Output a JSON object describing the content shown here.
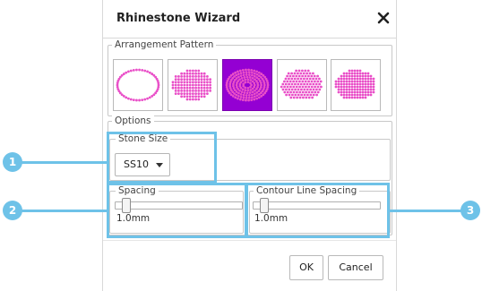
{
  "dialog": {
    "title": "Rhinestone Wizard",
    "close_icon": "close-icon"
  },
  "arrangement": {
    "legend": "Arrangement Pattern",
    "patterns": [
      {
        "name": "outline-ellipse",
        "selected": false
      },
      {
        "name": "horizontal-rows-fill",
        "selected": false
      },
      {
        "name": "concentric-contour-fill",
        "selected": true
      },
      {
        "name": "diagonal-fill",
        "selected": false
      },
      {
        "name": "grid-fill",
        "selected": false
      }
    ],
    "stone_color": "#e94fc8",
    "selected_bg": "#9400d3"
  },
  "options": {
    "legend": "Options",
    "stone_size": {
      "legend": "Stone Size",
      "value": "SS10"
    },
    "spacing": {
      "legend": "Spacing",
      "value_text": "1.0mm",
      "level": 0.05
    },
    "contour_line_spacing": {
      "legend": "Contour Line Spacing",
      "value_text": "1.0mm",
      "level": 0.05
    }
  },
  "buttons": {
    "ok": "OK",
    "cancel": "Cancel"
  },
  "callouts": {
    "color": "#6ec2e8",
    "labels": [
      "1",
      "2",
      "3"
    ]
  }
}
